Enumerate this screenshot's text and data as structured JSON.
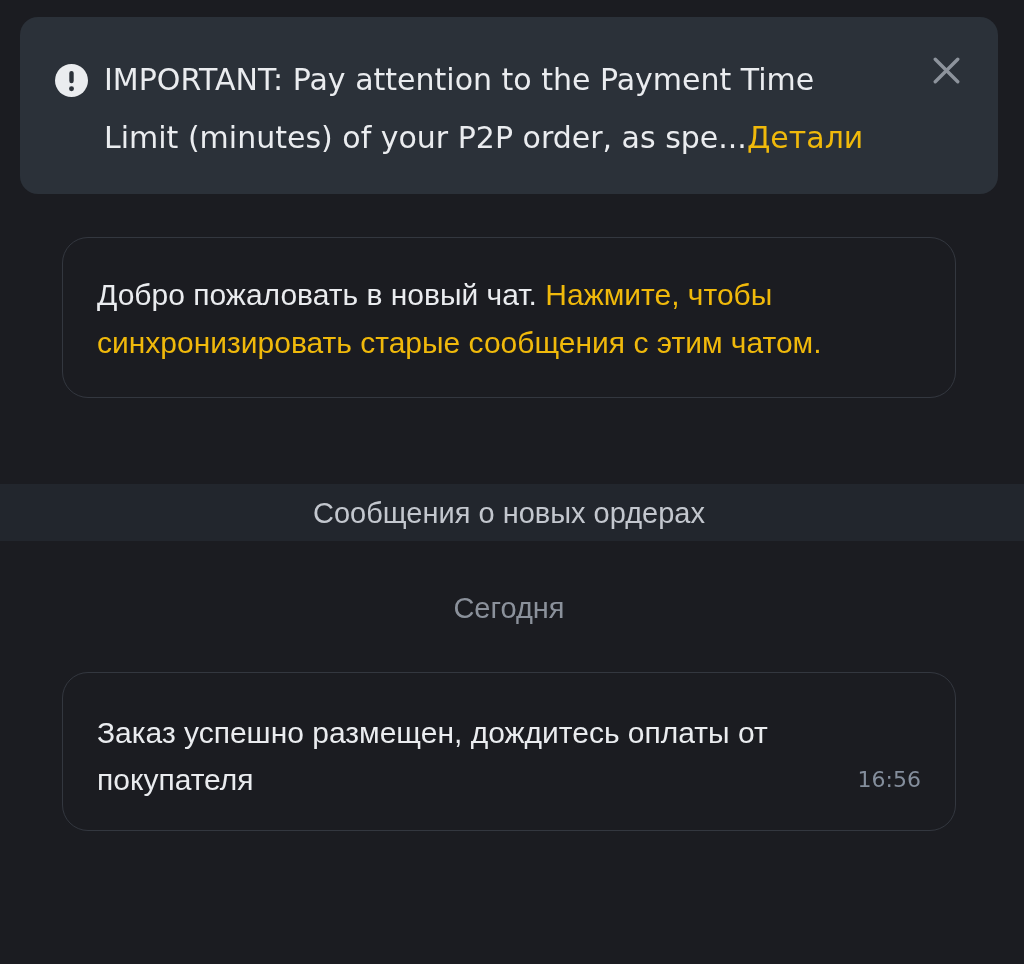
{
  "notice": {
    "text": "IMPORTANT: Pay attention to the Payment Time Limit (minutes) of your P2P order, as spe...",
    "link": "Детали"
  },
  "welcome": {
    "text": "Добро пожаловать в новый чат.",
    "action": "Нажмите, чтобы синхронизировать старые сообщения с этим чатом."
  },
  "section_header": "Сообщения о новых ордерах",
  "date_divider": "Сегодня",
  "messages": [
    {
      "text": "Заказ успешно размещен, дождитесь оплаты от покупателя",
      "time": "16:56"
    }
  ]
}
